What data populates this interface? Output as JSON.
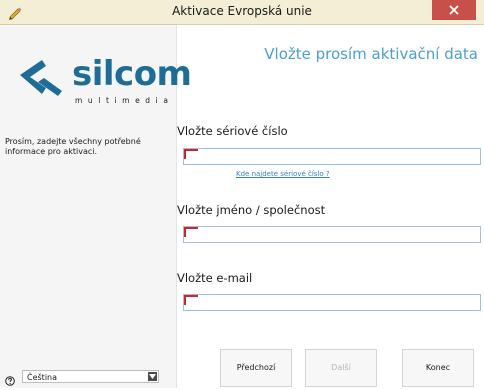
{
  "window": {
    "title": "Aktivace Evropská unie"
  },
  "header": {
    "heading": "Vložte prosím aktivační data"
  },
  "sidebar": {
    "logo_word": "silcom",
    "logo_subtitle": "multimedia",
    "info_text": "Prosím, zadejte všechny potřebné informace pro aktivaci.",
    "language": {
      "selected": "Čeština"
    }
  },
  "form": {
    "serial_label": "Vložte sériové číslo",
    "serial_value": "",
    "serial_link": "Kde najdete sériové číslo ?",
    "name_label": "Vložte jméno / společnost",
    "name_value": "",
    "email_label": "Vložte e-mail",
    "email_value": ""
  },
  "buttons": {
    "previous": "Předchozí",
    "next": "Další",
    "finish": "Konec"
  },
  "colors": {
    "accent": "#4a9ed2",
    "logo": "#1e6d97",
    "required_marker": "#d3222b",
    "close_button": "#c7504b",
    "titlebar": "#f3eed5"
  },
  "icons": {
    "app": "pencil-icon",
    "close": "close-icon",
    "help": "help-icon",
    "dropdown": "chevron-down-icon",
    "logo_mark": "silcom-logo-mark"
  }
}
